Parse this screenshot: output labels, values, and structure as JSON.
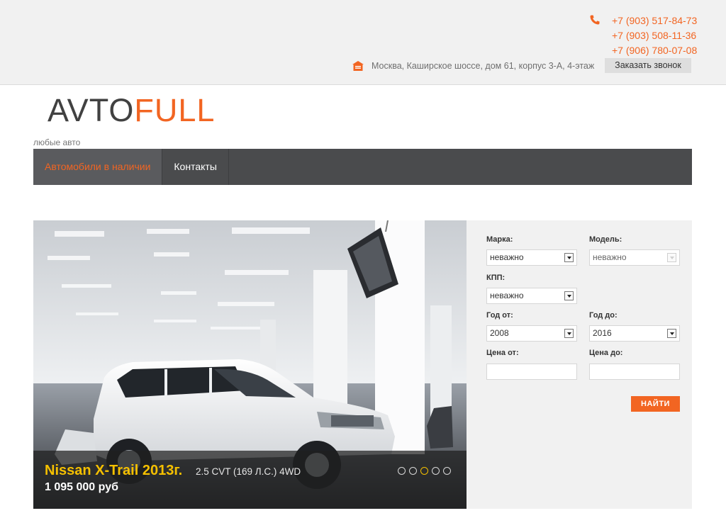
{
  "header": {
    "phones": [
      "+7 (903) 517-84-73",
      "+7 (903) 508-11-36",
      "+7 (906) 780-07-08"
    ],
    "address": "Москва, Каширское шоссе, дом 61, корпус 3-А, 4-этаж",
    "callback_label": "Заказать звонок",
    "phone_icon": "phone-icon",
    "address_icon": "home-icon"
  },
  "logo": {
    "part1": "AVTO",
    "part2": "FULL",
    "tagline": "любые авто"
  },
  "nav": {
    "items": [
      {
        "label": "Автомобили в наличии",
        "active": true
      },
      {
        "label": "Контакты",
        "active": false
      }
    ]
  },
  "slider": {
    "title": "Nissan X-Trail 2013г.",
    "spec": "2.5 CVT (169 Л.С.) 4WD",
    "price": "1 095 000 руб",
    "slide_count": 5,
    "active_slide": 3
  },
  "search": {
    "make_label": "Марка:",
    "make_value": "неважно",
    "model_label": "Модель:",
    "model_value": "неважно",
    "gearbox_label": "КПП:",
    "gearbox_value": "неважно",
    "year_from_label": "Год от:",
    "year_from_value": "2008",
    "year_to_label": "Год до:",
    "year_to_value": "2016",
    "price_from_label": "Цена от:",
    "price_from_value": "",
    "price_to_label": "Цена до:",
    "price_to_value": "",
    "submit_label": "НАЙТИ"
  },
  "colors": {
    "accent": "#f26522",
    "title_yellow": "#f5c000",
    "nav_bg": "#4a4b4d",
    "topbar_bg": "#f1f1f1"
  }
}
